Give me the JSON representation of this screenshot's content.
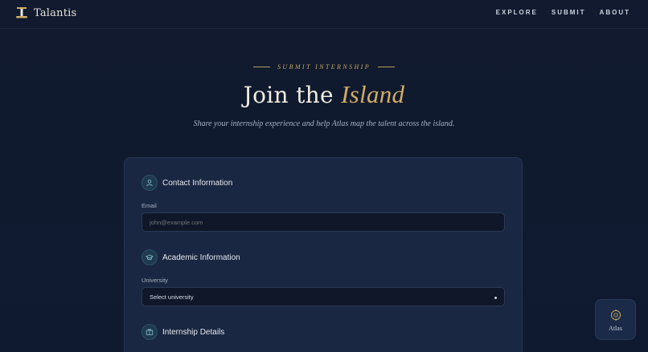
{
  "brand": {
    "name": "Talantis"
  },
  "nav": {
    "links": [
      "EXPLORE",
      "SUBMIT",
      "ABOUT"
    ]
  },
  "hero": {
    "eyebrow": "SUBMIT INTERNSHIP",
    "title_main": "Join the ",
    "title_accent": "Island",
    "subtitle": "Share your internship experience and help Atlas map the talent across the island."
  },
  "form": {
    "contact": {
      "title": "Contact Information",
      "icon": "user-icon",
      "email_label": "Email",
      "email_placeholder": "john@example.com"
    },
    "academic": {
      "title": "Academic Information",
      "icon": "graduation-cap-icon",
      "university_label": "University",
      "university_value": "Select university"
    },
    "internship": {
      "title": "Internship Details",
      "icon": "briefcase-icon"
    }
  },
  "atlas_widget": {
    "label": "Atlas",
    "icon": "compass-icon"
  },
  "colors": {
    "background": "#111a2e",
    "card": "#1a2742",
    "gold": "#d2ac62",
    "input": "#0f1729"
  }
}
